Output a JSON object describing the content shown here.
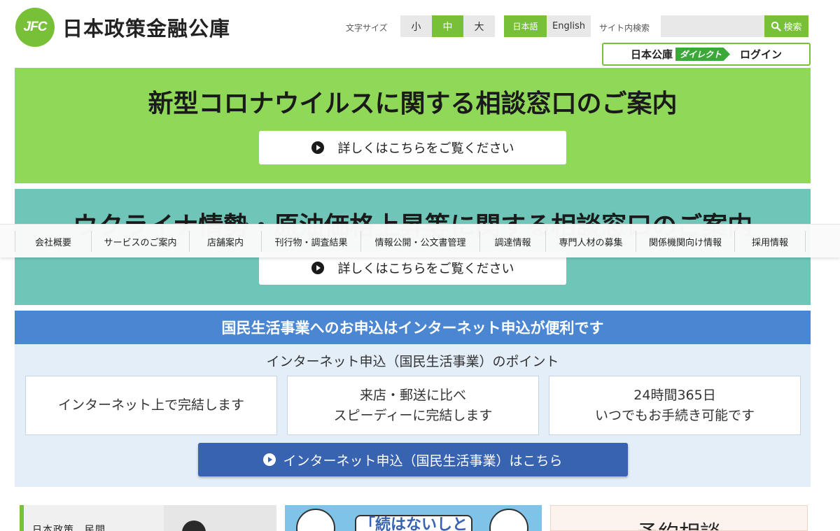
{
  "header": {
    "logo_mark": "JFC",
    "logo_text": "日本政策金融公庫",
    "font_size": {
      "label": "文字サイズ",
      "options": [
        "小",
        "中",
        "大"
      ],
      "selected": "中"
    },
    "language": {
      "ja": "日本語",
      "en": "English",
      "selected": "日本語"
    },
    "search": {
      "label": "サイト内検索",
      "placeholder": "",
      "button_label": "検索"
    },
    "direct_login": {
      "title": "日本公庫",
      "tag": "ダイレクト",
      "login_label": "ログイン"
    }
  },
  "banners": {
    "covid": {
      "title": "新型コロナウイルスに関する相談窓口のご案内",
      "button_label": "詳しくはこちらをご覧ください"
    },
    "ukraine": {
      "title": "ウクライナ情勢・原油価格上昇等に関する相談窓口のご案内",
      "button_label": "詳しくはこちらをご覧ください"
    }
  },
  "nav": {
    "items": [
      "会社概要",
      "サービスのご案内",
      "店舗案内",
      "刊行物・調査結果",
      "情報公開・公文書管理",
      "調達情報",
      "専門人材の募集",
      "関係機関向け情報",
      "採用情報"
    ]
  },
  "apply": {
    "heading": "国民生活事業へのお申込はインターネット申込が便利です",
    "subheading": "インターネット申込（国民生活事業）のポイント",
    "points": [
      {
        "line1": "インターネット上で完結します",
        "line2": ""
      },
      {
        "line1": "来店・郵送に比べ",
        "line2": "スピーディーに完結します"
      },
      {
        "line1": "24時間365日",
        "line2": "いつでもお手続き可能です"
      }
    ],
    "button_label": "インターネット申込（国民生活事業）はこちら"
  },
  "teasers": {
    "t1": "日本政策　民間",
    "t2": "「続はないしと",
    "t3": "予約相談"
  },
  "colors": {
    "accent_green": "#78c037",
    "banner_green": "#90d858",
    "banner_teal": "#6fc6b8",
    "apply_blue": "#4a86d2",
    "apply_button": "#3763b0"
  }
}
